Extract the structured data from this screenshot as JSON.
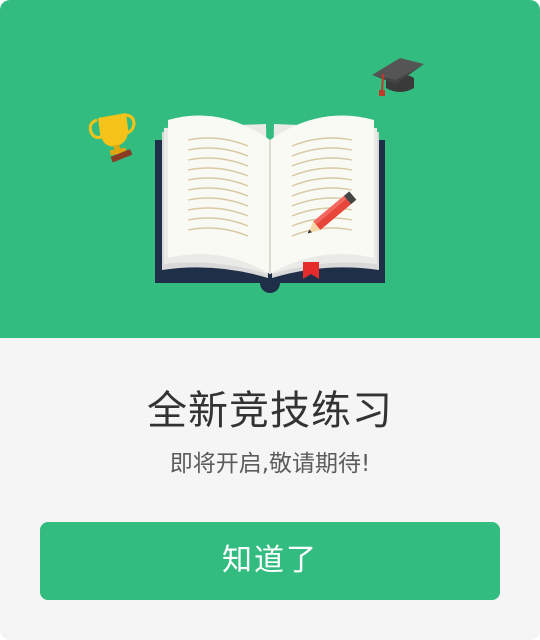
{
  "dialog": {
    "title": "全新竞技练习",
    "subtitle": "即将开启,敬请期待!",
    "confirm_label": "知道了"
  },
  "illustration": {
    "icons": [
      "open-book-icon",
      "trophy-icon",
      "graduation-cap-icon",
      "pencil-icon",
      "bookmark-icon"
    ]
  },
  "colors": {
    "accent": "#33bc80",
    "background": "#f5f5f5",
    "title_text": "#333333",
    "subtitle_text": "#5c5c5c",
    "button_text": "#ffffff"
  }
}
